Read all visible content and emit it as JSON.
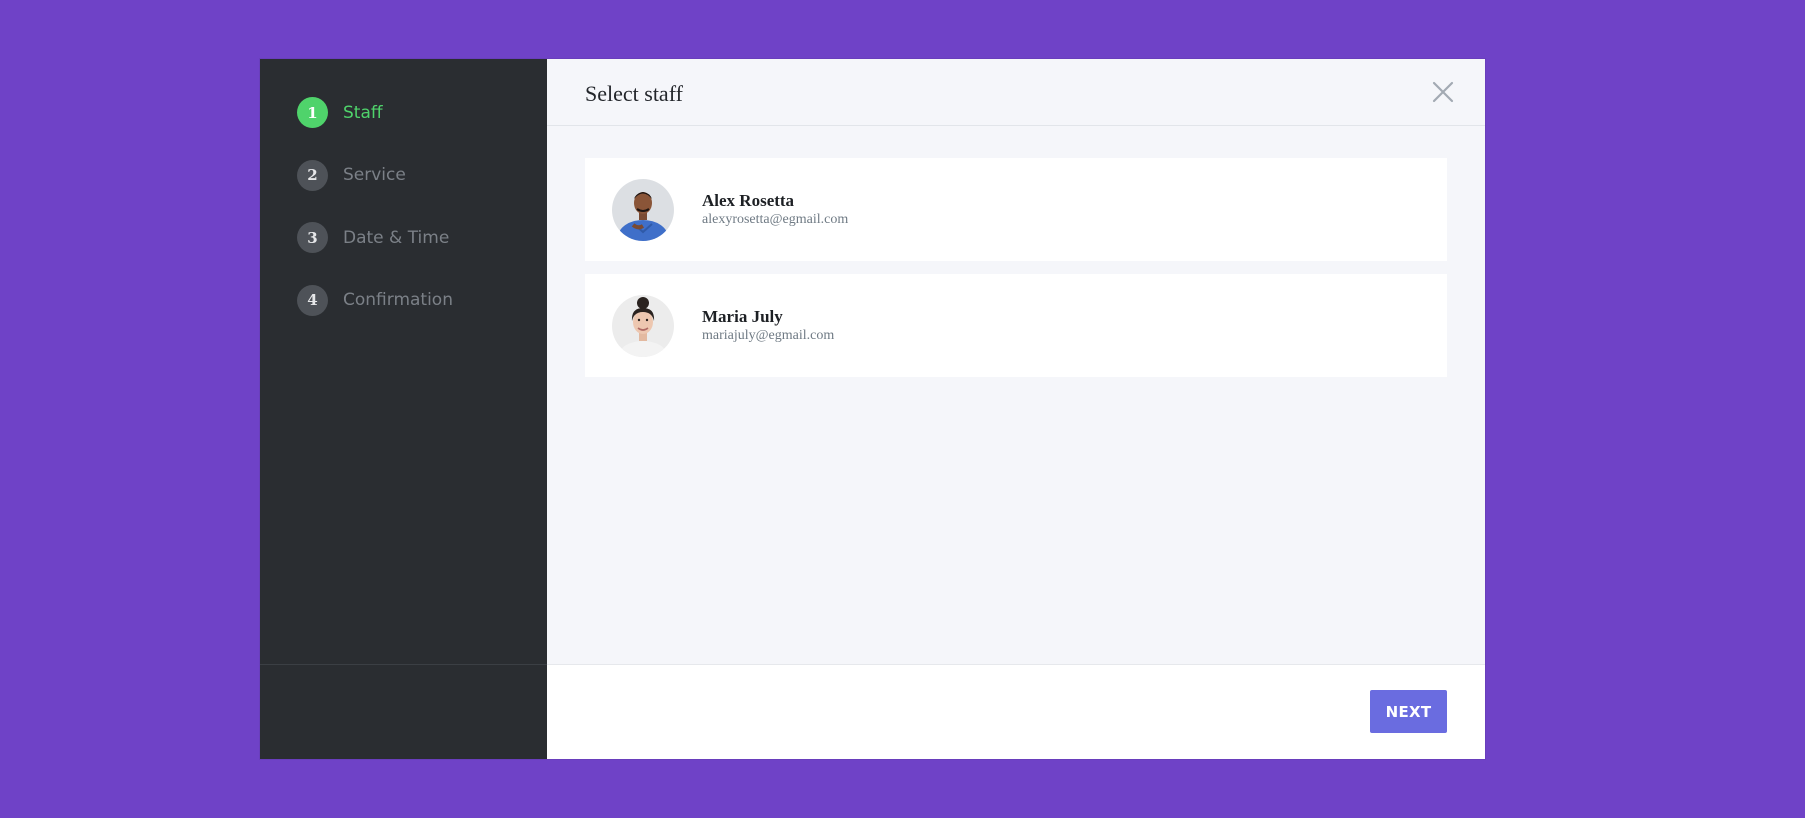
{
  "sidebar": {
    "steps": [
      {
        "number": "1",
        "label": "Staff",
        "active": true
      },
      {
        "number": "2",
        "label": "Service",
        "active": false
      },
      {
        "number": "3",
        "label": "Date & Time",
        "active": false
      },
      {
        "number": "4",
        "label": "Confirmation",
        "active": false
      }
    ]
  },
  "header": {
    "title": "Select staff",
    "close_icon": "close-icon"
  },
  "staff": [
    {
      "name": "Alex Rosetta",
      "email": "alexyrosetta@egmail.com",
      "avatar": "avatar-photo-man"
    },
    {
      "name": "Maria July",
      "email": "mariajuly@egmail.com",
      "avatar": "avatar-photo-woman"
    }
  ],
  "footer": {
    "next_label": "NEXT"
  },
  "colors": {
    "background": "#6f42c7",
    "sidebar": "#2a2d31",
    "active_step": "#4fd36b",
    "inactive_step": "#4e5258",
    "primary_button": "#6a6ce0"
  }
}
